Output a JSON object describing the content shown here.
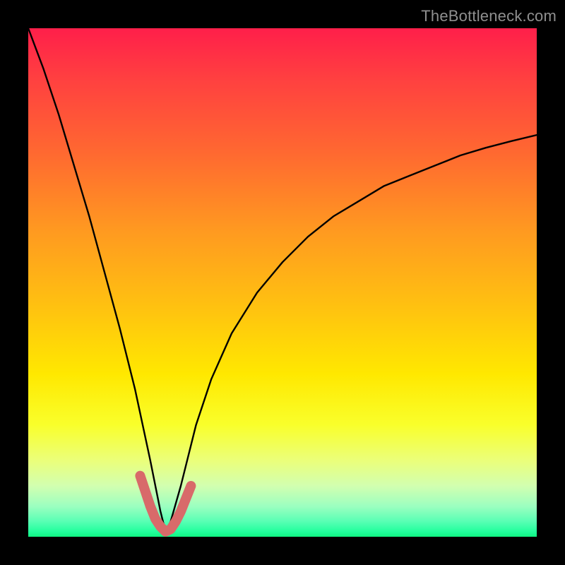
{
  "watermark": "TheBottleneck.com",
  "colors": {
    "page_bg": "#000000",
    "curve": "#000000",
    "highlight": "#d86a6a",
    "gradient_top": "#ff1f4a",
    "gradient_bottom": "#10f582"
  },
  "chart_data": {
    "type": "line",
    "title": "",
    "xlabel": "",
    "ylabel": "",
    "xlim": [
      0,
      100
    ],
    "ylim": [
      0,
      100
    ],
    "grid": false,
    "legend": false,
    "note": "V-shaped bottleneck curve; y is distance-from-optimal (0 = perfect match at green band). Minimum near x≈27.",
    "series": [
      {
        "name": "bottleneck-curve",
        "x": [
          0,
          3,
          6,
          9,
          12,
          15,
          18,
          21,
          24,
          26,
          27,
          28,
          30,
          33,
          36,
          40,
          45,
          50,
          55,
          60,
          65,
          70,
          75,
          80,
          85,
          90,
          95,
          100
        ],
        "y": [
          100,
          92,
          83,
          73,
          63,
          52,
          41,
          29,
          15,
          5,
          1,
          3,
          10,
          22,
          31,
          40,
          48,
          54,
          59,
          63,
          66,
          69,
          71,
          73,
          75,
          76.5,
          77.8,
          79
        ]
      },
      {
        "name": "highlight-near-minimum",
        "x": [
          22,
          23,
          24,
          25,
          26,
          27,
          28,
          29,
          30,
          31,
          32
        ],
        "y": [
          12,
          9,
          6,
          3.5,
          2,
          1,
          1.5,
          3,
          5,
          7.5,
          10
        ]
      }
    ]
  }
}
